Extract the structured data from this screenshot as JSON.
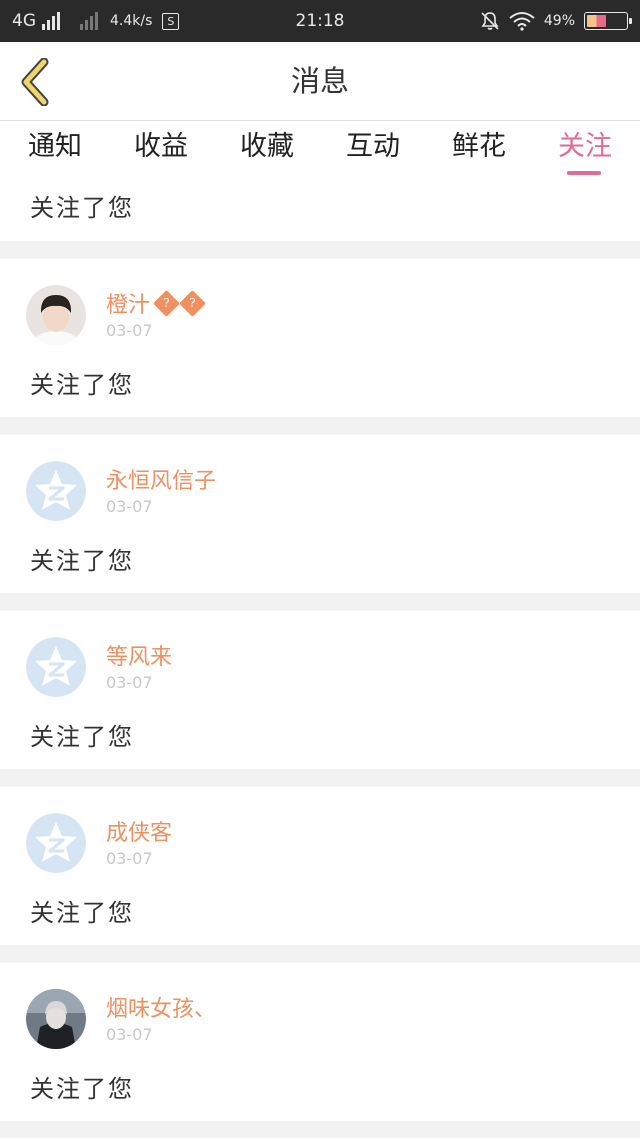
{
  "status_bar": {
    "network": "4G",
    "speed": "4.4k/s",
    "s_icon": "S",
    "time": "21:18",
    "battery": "49%",
    "battery_level": 0.49
  },
  "header": {
    "title": "消息",
    "back_icon": "chevron-left-icon"
  },
  "tabs": [
    {
      "label": "通知",
      "active": false
    },
    {
      "label": "收益",
      "active": false
    },
    {
      "label": "收藏",
      "active": false
    },
    {
      "label": "互动",
      "active": false
    },
    {
      "label": "鲜花",
      "active": false
    },
    {
      "label": "关注",
      "active": true
    }
  ],
  "colors": {
    "accent": "#e06a9a",
    "username": "#ee9060",
    "date": "#c8c8c8"
  },
  "partial_item": {
    "message": "关注了您"
  },
  "items": [
    {
      "username": "橙汁",
      "badges": [
        "?",
        "?"
      ],
      "date": "03-07",
      "message": "关注了您",
      "avatar": "photo-avatar"
    },
    {
      "username": "永恒风信子",
      "date": "03-07",
      "message": "关注了您",
      "avatar": "qzone-default-avatar"
    },
    {
      "username": "等风来",
      "date": "03-07",
      "message": "关注了您",
      "avatar": "qzone-default-avatar"
    },
    {
      "username": "成侠客",
      "date": "03-07",
      "message": "关注了您",
      "avatar": "qzone-default-avatar"
    },
    {
      "username": "烟味女孩、",
      "date": "03-07",
      "message": "关注了您",
      "avatar": "photo-avatar"
    }
  ]
}
